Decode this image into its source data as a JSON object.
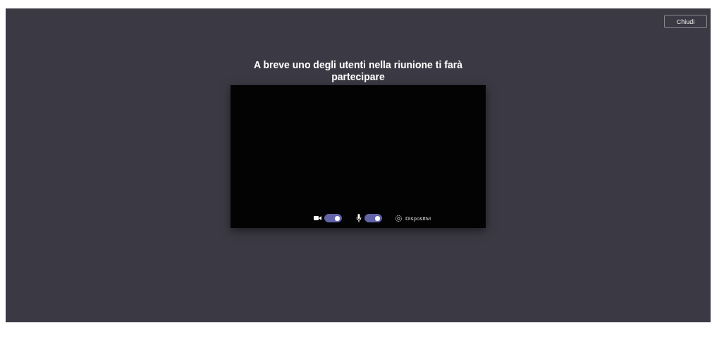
{
  "close_button": {
    "label": "Chiudi"
  },
  "title": "A breve uno degli utenti nella riunione ti farà partecipare",
  "preview": {
    "camera": {
      "on": true
    },
    "microphone": {
      "on": true
    },
    "devices_button": {
      "label": "Dispositivi"
    }
  }
}
